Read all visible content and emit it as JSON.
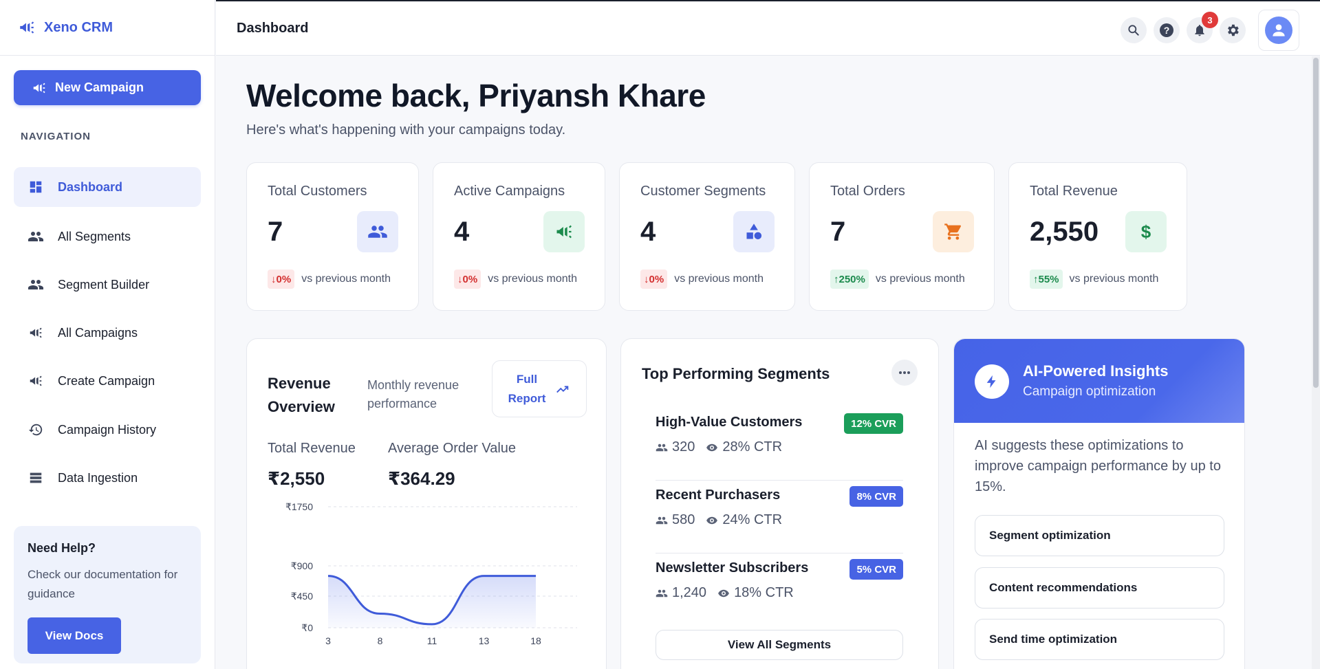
{
  "brand": {
    "name": "Xeno CRM"
  },
  "sidebar": {
    "new_campaign_label": "New Campaign",
    "nav_title": "NAVIGATION",
    "items": [
      {
        "label": "Dashboard",
        "icon": "dashboard-icon",
        "active": true
      },
      {
        "label": "All Segments",
        "icon": "people-icon"
      },
      {
        "label": "Segment Builder",
        "icon": "people-icon"
      },
      {
        "label": "All Campaigns",
        "icon": "megaphone-icon"
      },
      {
        "label": "Create Campaign",
        "icon": "megaphone-icon"
      },
      {
        "label": "Campaign History",
        "icon": "history-icon"
      },
      {
        "label": "Data Ingestion",
        "icon": "list-icon"
      }
    ],
    "help": {
      "title": "Need Help?",
      "text": "Check our documentation for guidance",
      "button": "View Docs"
    }
  },
  "topbar": {
    "title": "Dashboard",
    "notification_count": "3"
  },
  "main": {
    "welcome": "Welcome back, Priyansh Khare",
    "subtitle": "Here's what's happening with your campaigns today.",
    "stats": [
      {
        "label": "Total Customers",
        "value": "7",
        "change": "0%",
        "direction": "down",
        "compare": "vs previous month",
        "icon": "people-icon",
        "color": "#3f5bd9"
      },
      {
        "label": "Active Campaigns",
        "value": "4",
        "change": "0%",
        "direction": "down",
        "compare": "vs previous month",
        "icon": "megaphone-icon",
        "color": "#1b8a4c"
      },
      {
        "label": "Customer Segments",
        "value": "4",
        "change": "0%",
        "direction": "down",
        "compare": "vs previous month",
        "icon": "shapes-icon",
        "color": "#3f5bd9"
      },
      {
        "label": "Total Orders",
        "value": "7",
        "change": "250%",
        "direction": "up",
        "compare": "vs previous month",
        "icon": "cart-icon",
        "color": "#e8711e"
      },
      {
        "label": "Total Revenue",
        "value": "2,550",
        "change": "55%",
        "direction": "up",
        "compare": "vs previous month",
        "icon": "dollar-icon",
        "color": "#1b8a4c"
      }
    ],
    "revenue": {
      "title_line1": "Revenue",
      "title_line2": "Overview",
      "sub_line1": "Monthly revenue",
      "sub_line2": "performance",
      "report_line1": "Full",
      "report_line2": "Report",
      "total_revenue_label": "Total Revenue",
      "total_revenue_value": "₹2,550",
      "aov_label": "Average Order Value",
      "aov_value": "₹364.29"
    },
    "segments": {
      "title": "Top Performing Segments",
      "items": [
        {
          "name": "High-Value Customers",
          "cvr": "12% CVR",
          "cvr_color": "#1b9e5a",
          "users": "320",
          "ctr": "28% CTR"
        },
        {
          "name": "Recent Purchasers",
          "cvr": "8% CVR",
          "cvr_color": "#4763e4",
          "users": "580",
          "ctr": "24% CTR"
        },
        {
          "name": "Newsletter Subscribers",
          "cvr": "5% CVR",
          "cvr_color": "#4763e4",
          "users": "1,240",
          "ctr": "18% CTR"
        }
      ],
      "view_all": "View All Segments"
    },
    "ai": {
      "title": "AI-Powered Insights",
      "subtitle": "Campaign optimization",
      "text": "AI suggests these optimizations to improve campaign performance by up to 15%.",
      "options": [
        "Segment optimization",
        "Content recommendations",
        "Send time optimization"
      ]
    }
  },
  "chart_data": {
    "type": "area",
    "x": [
      3,
      8,
      11,
      13,
      18
    ],
    "y_ticks": [
      "₹1750",
      "₹900",
      "₹450",
      "₹0"
    ],
    "y_tick_values": [
      1750,
      900,
      450,
      0
    ],
    "series": [
      {
        "values": [
          750,
          200,
          50,
          750,
          750
        ]
      }
    ],
    "ylim": [
      0,
      1750
    ],
    "grid": true,
    "color": "#3f5bd9"
  }
}
